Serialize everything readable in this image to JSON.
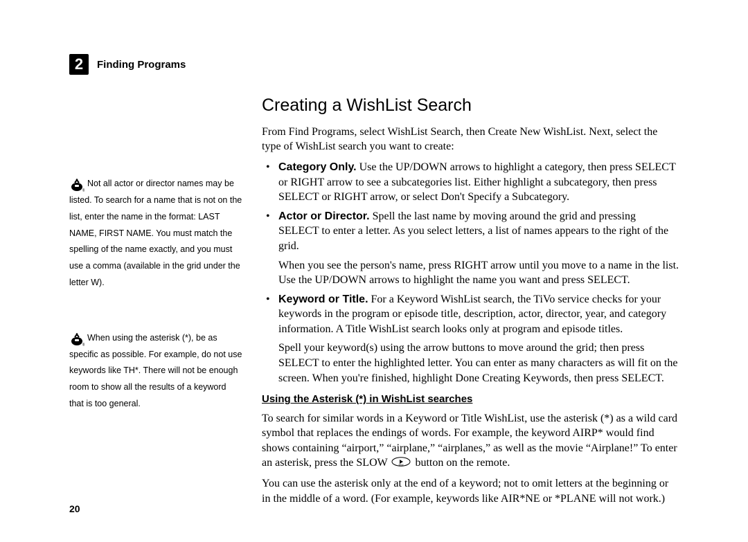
{
  "header": {
    "chapter_number": "2",
    "chapter_title": "Finding Programs"
  },
  "sidebar": {
    "note1": "Not all actor or director names may be listed. To search for a name that is not on the list, enter the name in the format: LAST NAME, FIRST NAME. You must match the spelling of the name exactly, and you must use a comma (available in the grid under the letter W).",
    "note2": "When using the asterisk (*), be as specific as possible. For example, do not use keywords like TH*. There will not be enough room to show all the results of a keyword that is too general."
  },
  "main": {
    "title": "Creating a WishList Search",
    "intro": "From Find Programs, select WishList Search, then Create New WishList. Next, select the type of WishList search you want to create:",
    "bullets": {
      "b1_label": "Category Only.",
      "b1_text": " Use the UP/DOWN arrows to highlight a category, then press SELECT or RIGHT arrow to see a subcategories list. Either highlight a subcategory, then press SELECT or RIGHT arrow, or select Don't Specify a Subcategory.",
      "b2_label": "Actor or Director.",
      "b2_text": " Spell the last name by moving around the grid and pressing SELECT to enter a letter. As you select letters, a list of names appears to the right of the grid.",
      "b2_p2": "When you see the person's name, press RIGHT arrow until you move to a name in the list. Use the UP/DOWN arrows to highlight the name you want and press SELECT.",
      "b3_label": "Keyword or Title.",
      "b3_text": " For a Keyword WishList search, the TiVo service checks for your keywords in the program or episode title, description, actor, director, year, and category information. A Title WishList search looks only at program and episode titles.",
      "b3_p2": "Spell your keyword(s) using the arrow buttons to move around the grid; then press SELECT to enter the highlighted letter. You can enter as many characters as will fit on the screen. When you're finished, highlight Done Creating Keywords, then press SELECT."
    },
    "subhead": "Using the Asterisk (*) in WishList searches",
    "asterisk_p1a": "To search for similar words in a Keyword or Title WishList, use the asterisk (*) as a wild card symbol that replaces the endings of words. For example, the keyword AIRP* would find shows containing “airport,” “airplane,” “airplanes,” as well as the movie “Airplane!” To enter an asterisk, press the SLOW ",
    "asterisk_p1b": " button on the remote.",
    "asterisk_p2": "You can use the asterisk only at the end of a keyword; not to omit letters at the beginning or in the middle of a word. (For example, keywords like AIR*NE or *PLANE will not work.)"
  },
  "page_number": "20"
}
